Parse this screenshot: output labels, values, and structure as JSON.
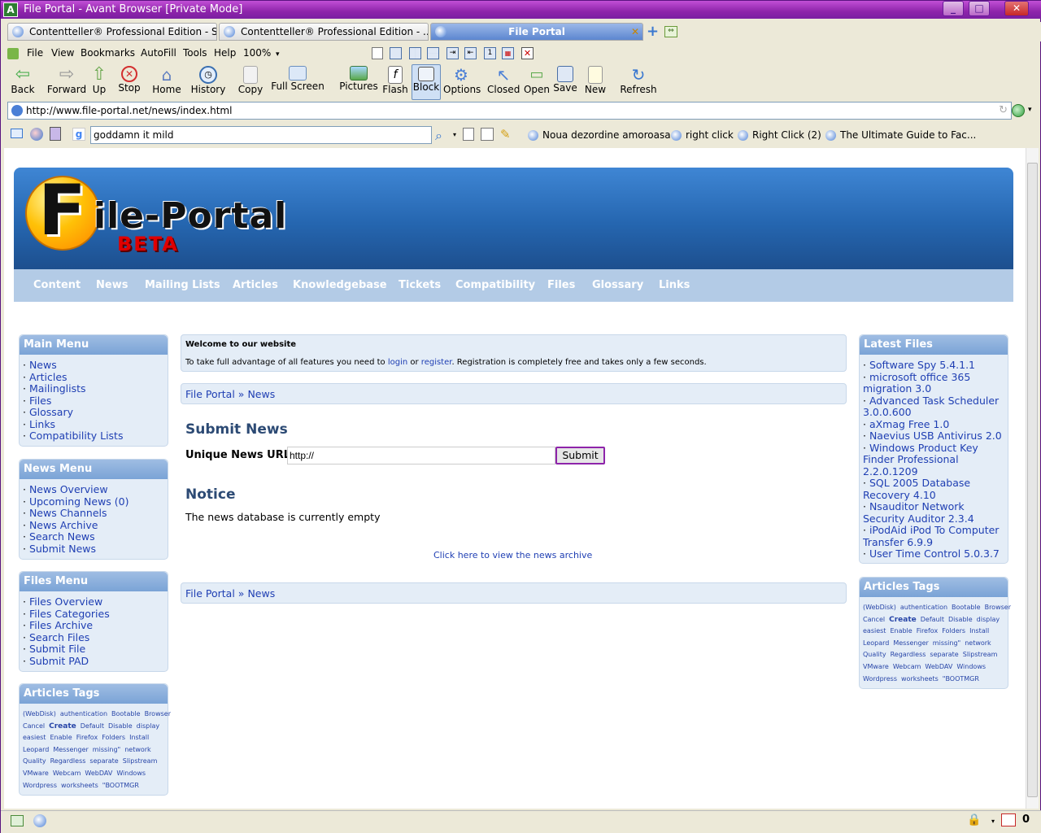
{
  "window": {
    "title": "File Portal - Avant Browser [Private Mode]",
    "buttons": {
      "minimize": "_",
      "maximize": "□",
      "close": "✕"
    }
  },
  "tabs": [
    {
      "label": "Contentteller® Professional Edition - S..."
    },
    {
      "label": "Contentteller® Professional Edition - ..."
    },
    {
      "label": "File Portal"
    }
  ],
  "menu": {
    "items": [
      "File",
      "View",
      "Bookmarks",
      "AutoFill",
      "Tools",
      "Help"
    ],
    "zoom": "100%"
  },
  "toolbar": {
    "buttons": [
      "Back",
      "Forward",
      "Up",
      "Stop",
      "Home",
      "History",
      "Copy",
      "Full Screen",
      "Pictures",
      "Flash",
      "Block",
      "Options",
      "Closed",
      "Open",
      "Save",
      "New",
      "Refresh"
    ]
  },
  "address": {
    "url": "http://www.file-portal.net/news/index.html"
  },
  "linksbar": {
    "search_value": "goddamn it mild",
    "links": [
      "Noua dezordine amoroasa",
      "right click",
      "Right Click (2)",
      "The Ultimate Guide to Fac..."
    ]
  },
  "site": {
    "logo_text": "ile-Portal",
    "logo_letter": "F",
    "logo_beta": "BETA",
    "nav": [
      "Content",
      "News",
      "Mailing Lists",
      "Articles",
      "Knowledgebase",
      "Tickets",
      "Compatibility",
      "Files",
      "Glossary",
      "Links"
    ]
  },
  "main_menu": {
    "title": "Main Menu",
    "items": [
      "News",
      "Articles",
      "Mailinglists",
      "Files",
      "Glossary",
      "Links",
      "Compatibility Lists"
    ]
  },
  "news_menu": {
    "title": "News Menu",
    "items": [
      "News Overview",
      "Upcoming News (0)",
      "News Channels",
      "News Archive",
      "Search News",
      "Submit News"
    ]
  },
  "files_menu": {
    "title": "Files Menu",
    "items": [
      "Files Overview",
      "Files Categories",
      "Files Archive",
      "Search Files",
      "Submit File",
      "Submit PAD"
    ]
  },
  "articles_tags": {
    "title": "Articles Tags",
    "tags": [
      "(WebDisk)",
      "authentication",
      "Bootable",
      "Browser",
      "Cancel",
      "Create",
      "Default",
      "Disable",
      "display",
      "easiest",
      "Enable",
      "Firefox",
      "Folders",
      "Install",
      "Leopard",
      "Messenger",
      "missing\"",
      "network",
      "Quality",
      "Regardless",
      "separate",
      "Slipstream",
      "VMware",
      "Webcam",
      "WebDAV",
      "Windows",
      "Wordpress",
      "worksheets",
      "\"BOOTMGR"
    ]
  },
  "welcome": {
    "title": "Welcome to our website",
    "text_before": "To take full advantage of all features you need to ",
    "login": "login",
    "or": " or ",
    "register": "register",
    "text_after": ". Registration is completely free and takes only a few seconds."
  },
  "breadcrumb": {
    "root": "File Portal",
    "sep": "»",
    "current": "News"
  },
  "submit_news": {
    "heading": "Submit News",
    "label": "Unique News URL:",
    "value": "http://",
    "button": "Submit"
  },
  "notice": {
    "heading": "Notice",
    "text": "The news database is currently empty",
    "archive_link": "Click here to view the news archive"
  },
  "latest_files": {
    "title": "Latest Files",
    "items": [
      "Software Spy 5.4.1.1",
      "microsoft office 365 migration 3.0",
      "Advanced Task Scheduler 3.0.0.600",
      "aXmag Free 1.0",
      "Naevius USB Antivirus 2.0",
      "Windows Product Key Finder Professional 2.2.0.1209",
      "SQL 2005 Database Recovery 4.10",
      "Nsauditor Network Security Auditor 2.3.4",
      "iPodAid iPod To Computer Transfer 6.9.9",
      "User Time Control 5.0.3.7"
    ]
  },
  "status": {
    "count": "0"
  }
}
